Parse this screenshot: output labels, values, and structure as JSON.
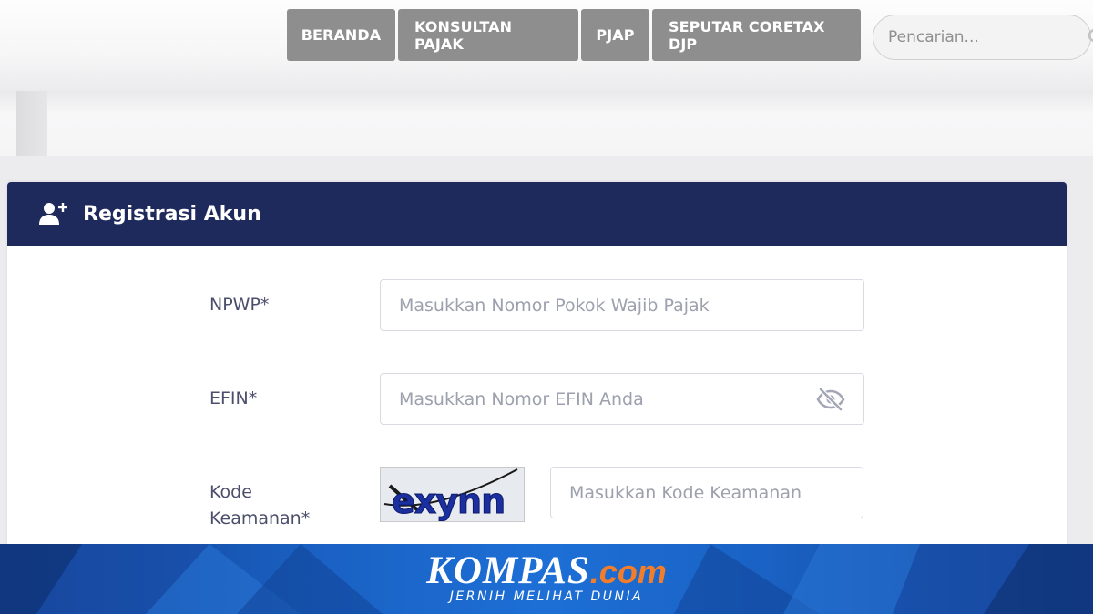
{
  "nav": {
    "items": [
      {
        "label": "BERANDA"
      },
      {
        "label": "KONSULTAN PAJAK"
      },
      {
        "label": "PJAP"
      },
      {
        "label": "SEPUTAR CORETAX DJP"
      }
    ],
    "search_placeholder": "Pencarian..."
  },
  "card": {
    "title": "Registrasi Akun",
    "fields": {
      "npwp": {
        "label": "NPWP*",
        "placeholder": "Masukkan Nomor Pokok Wajib Pajak"
      },
      "efin": {
        "label": "EFIN*",
        "placeholder": "Masukkan Nomor EFIN Anda"
      },
      "kode": {
        "label_line1": "Kode",
        "label_line2": "Keamanan*",
        "placeholder": "Masukkan Kode Keamanan"
      }
    },
    "captcha_text": "exynn"
  },
  "banner": {
    "brand": "KOMPAS",
    "brand_suffix": ".com",
    "tagline": "JERNIH MELIHAT DUNIA"
  },
  "colors": {
    "nav_button": "#8e8e8e",
    "card_header": "#1f2a5c",
    "label_text": "#4b4f6b",
    "banner_blue": "#1a62c4",
    "brand_orange": "#f27d2a"
  },
  "icons": [
    "search-icon",
    "add-user-icon",
    "eye-slash-icon"
  ]
}
